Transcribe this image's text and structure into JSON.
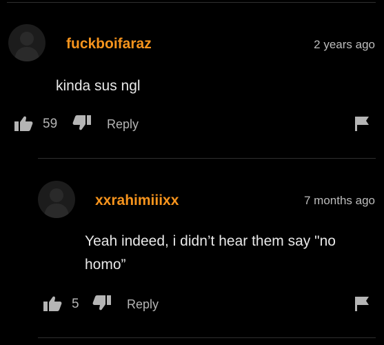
{
  "theme": {
    "background": "#000000",
    "username_color": "#f7941d",
    "text_color": "#e8e8e8",
    "muted_color": "#b5b5b5"
  },
  "comments": [
    {
      "username": "fuckboifaraz",
      "timestamp": "2 years ago",
      "text": "kinda sus ngl",
      "likes": "59",
      "reply_label": "Reply",
      "avatar_icon": "default-user-avatar",
      "like_icon": "thumbs-up-icon",
      "dislike_icon": "thumbs-down-icon",
      "report_icon": "flag-icon"
    },
    {
      "username": "xxrahimiiixx",
      "timestamp": "7 months ago",
      "text_line1": "Yeah indeed, i didn’t hear them say \"no",
      "text_line2": "homo”",
      "likes": "5",
      "reply_label": "Reply",
      "avatar_icon": "default-user-avatar",
      "like_icon": "thumbs-up-icon",
      "dislike_icon": "thumbs-down-icon",
      "report_icon": "flag-icon"
    }
  ]
}
